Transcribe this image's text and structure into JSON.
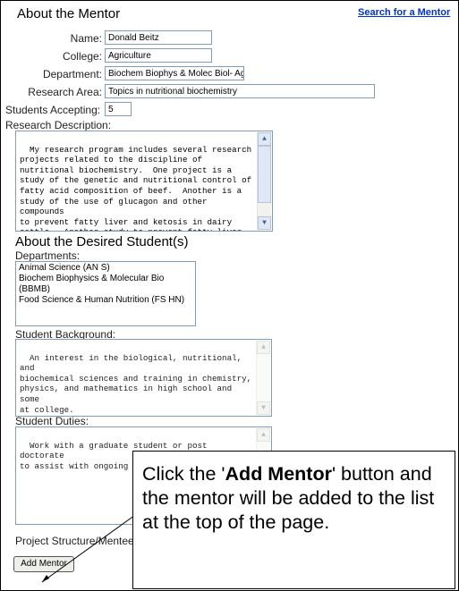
{
  "mentor": {
    "heading": "About the Mentor",
    "search_link": "Search for a Mentor",
    "name_label": "Name:",
    "name_value": "Donald Beitz",
    "college_label": "College:",
    "college_value": "Agriculture",
    "department_label": "Department:",
    "department_value": "Biochem Biophys & Molec Biol- Ag",
    "research_area_label": "Research Area:",
    "research_area_value": "Topics in nutritional biochemistry",
    "students_accepting_label": "Students Accepting:",
    "students_accepting_value": "5",
    "research_description_label": "Research Description:",
    "research_description_text": "My research program includes several research\nprojects related to the discipline of\nnutritional biochemistry.  One project is a\nstudy of the genetic and nutritional control of\nfatty acid composition of beef.  Another is a\nstudy of the use of glucagon and other compounds\nto prevent fatty liver and ketosis in dairy\ncattle.  Another study to prevent fatty liver in\nhumans with rats as animal models is underway.\nAnother project relates evaluating healthiness"
  },
  "student": {
    "heading": "About the Desired Student(s)",
    "departments_label": "Departments:",
    "departments": [
      "Animal Science (AN S)",
      "Biochem Biophysics & Molecular Bio (BBMB)",
      "Food Science & Human Nutrition (FS HN)"
    ],
    "background_label": "Student Background:",
    "background_text": "An interest in the biological, nutritional, and\nbiochemical sciences and training in chemistry,\nphysics, and mathematics in high school and some\nat college.",
    "duties_label": "Student Duties:",
    "duties_text": "Work with a graduate student or post doctorate\nto assist with ongoing research.",
    "project_structure_label": "Project Structure/Mentee de",
    "add_button_label": "Add Mentor"
  },
  "callout": {
    "text_before": "Click the '",
    "bold": "Add Mentor",
    "text_after": "' button and the mentor will be added to the list at the top of the page."
  },
  "icons": {
    "scroll_up": "scroll-up-arrow-icon",
    "scroll_down": "scroll-down-arrow-icon"
  }
}
